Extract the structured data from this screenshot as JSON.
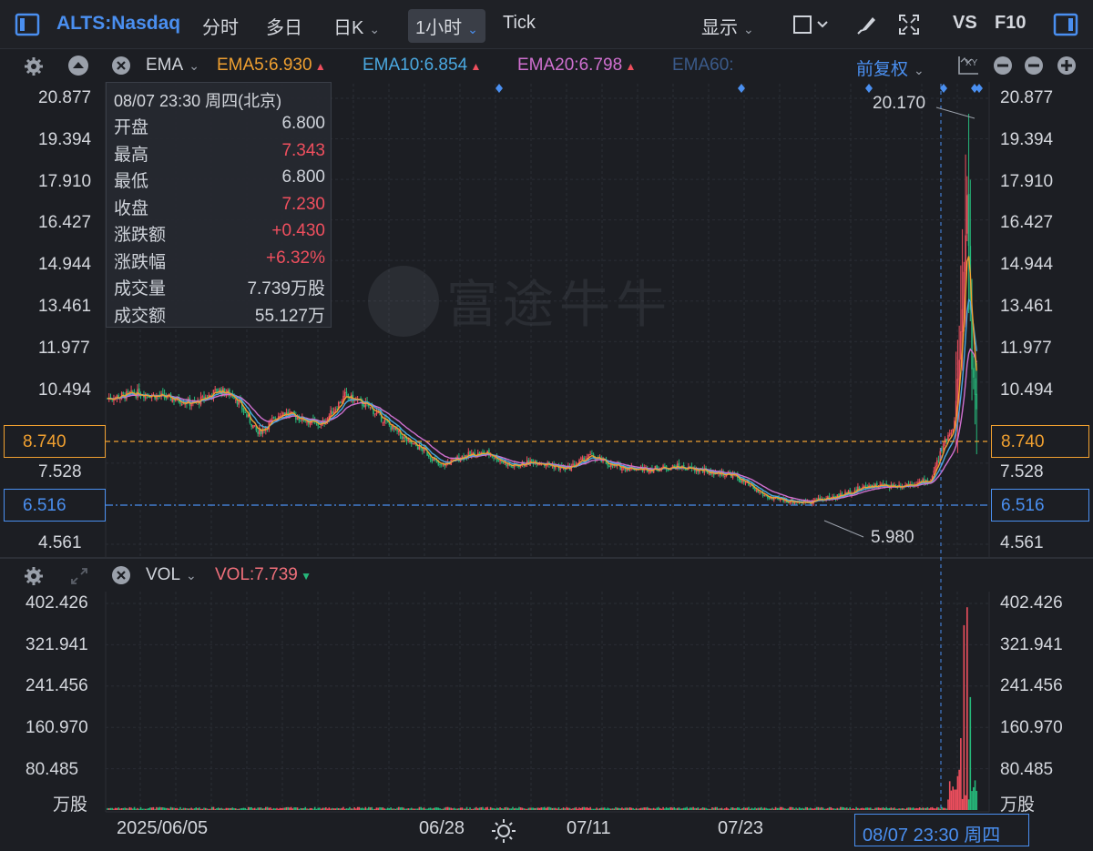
{
  "toolbar": {
    "symbol": "ALTS:Nasdaq",
    "tabs": [
      "分时",
      "多日",
      "日K",
      "1小时",
      "Tick"
    ],
    "active_tab": "1小时",
    "display_label": "显示",
    "vs_label": "VS",
    "f10_label": "F10"
  },
  "ema_row": {
    "name": "EMA",
    "ema5": "EMA5:6.930",
    "ema10": "EMA10:6.854",
    "ema20": "EMA20:6.798",
    "ema60": "EMA60:",
    "adjust": "前复权",
    "xy_label": "XY"
  },
  "vol_row": {
    "name": "VOL",
    "vol": "VOL:7.739"
  },
  "tooltip": {
    "title": "08/07 23:30 周四(北京)",
    "rows": [
      {
        "k": "开盘",
        "v": "6.800",
        "red": false
      },
      {
        "k": "最高",
        "v": "7.343",
        "red": true
      },
      {
        "k": "最低",
        "v": "6.800",
        "red": false
      },
      {
        "k": "收盘",
        "v": "7.230",
        "red": true
      },
      {
        "k": "涨跌额",
        "v": "+0.430",
        "red": true
      },
      {
        "k": "涨跌幅",
        "v": "+6.32%",
        "red": true
      },
      {
        "k": "成交量",
        "v": "7.739万股",
        "red": false
      },
      {
        "k": "成交额",
        "v": "55.127万",
        "red": false
      }
    ]
  },
  "watermark": "富途牛牛",
  "price_axis": [
    "20.877",
    "19.394",
    "17.910",
    "16.427",
    "14.944",
    "13.461",
    "11.977",
    "10.494",
    "7.528",
    "4.561"
  ],
  "vol_axis": [
    "402.426",
    "321.941",
    "241.456",
    "160.970",
    "80.485",
    "万股"
  ],
  "price_tags": {
    "orange": "8.740",
    "blue": "6.516"
  },
  "annotations": {
    "high": "20.170",
    "low": "5.980"
  },
  "x_axis": [
    "2025/06/05",
    "06/28",
    "07/11",
    "07/23"
  ],
  "time_tag": "08/07 23:30 周四",
  "colors": {
    "up": "#ef4f5e",
    "down": "#26b87a",
    "ema5": "#f0a030",
    "ema10": "#4aa8e0",
    "ema20": "#d070d0",
    "ema60": "#3a5a8a",
    "accent": "#4a8ff0"
  },
  "chart_data": {
    "type": "candlestick",
    "price_range": [
      4.561,
      20.877
    ],
    "volume_range": [
      0,
      402.426
    ],
    "anchors": [
      [
        0,
        9.9
      ],
      [
        20,
        10.1
      ],
      [
        40,
        9.9
      ],
      [
        55,
        9.7
      ],
      [
        70,
        10.2
      ],
      [
        80,
        10.0
      ],
      [
        95,
        8.6
      ],
      [
        110,
        9.4
      ],
      [
        125,
        9.1
      ],
      [
        135,
        8.9
      ],
      [
        150,
        10.0
      ],
      [
        165,
        9.6
      ],
      [
        180,
        8.8
      ],
      [
        190,
        8.3
      ],
      [
        200,
        8.0
      ],
      [
        210,
        7.4
      ],
      [
        225,
        7.8
      ],
      [
        240,
        7.9
      ],
      [
        255,
        7.4
      ],
      [
        270,
        7.6
      ],
      [
        290,
        7.3
      ],
      [
        305,
        7.8
      ],
      [
        320,
        7.4
      ],
      [
        340,
        7.3
      ],
      [
        360,
        7.4
      ],
      [
        380,
        7.2
      ],
      [
        395,
        7.1
      ],
      [
        410,
        6.5
      ],
      [
        420,
        6.2
      ],
      [
        440,
        6.1
      ],
      [
        460,
        6.3
      ],
      [
        480,
        6.7
      ],
      [
        500,
        6.7
      ],
      [
        520,
        6.9
      ],
      [
        528,
        8.2
      ],
      [
        535,
        9.0
      ],
      [
        540,
        13.0
      ],
      [
        543,
        17.5
      ],
      [
        546,
        11.0
      ],
      [
        549,
        9.5
      ]
    ],
    "count": 550
  }
}
